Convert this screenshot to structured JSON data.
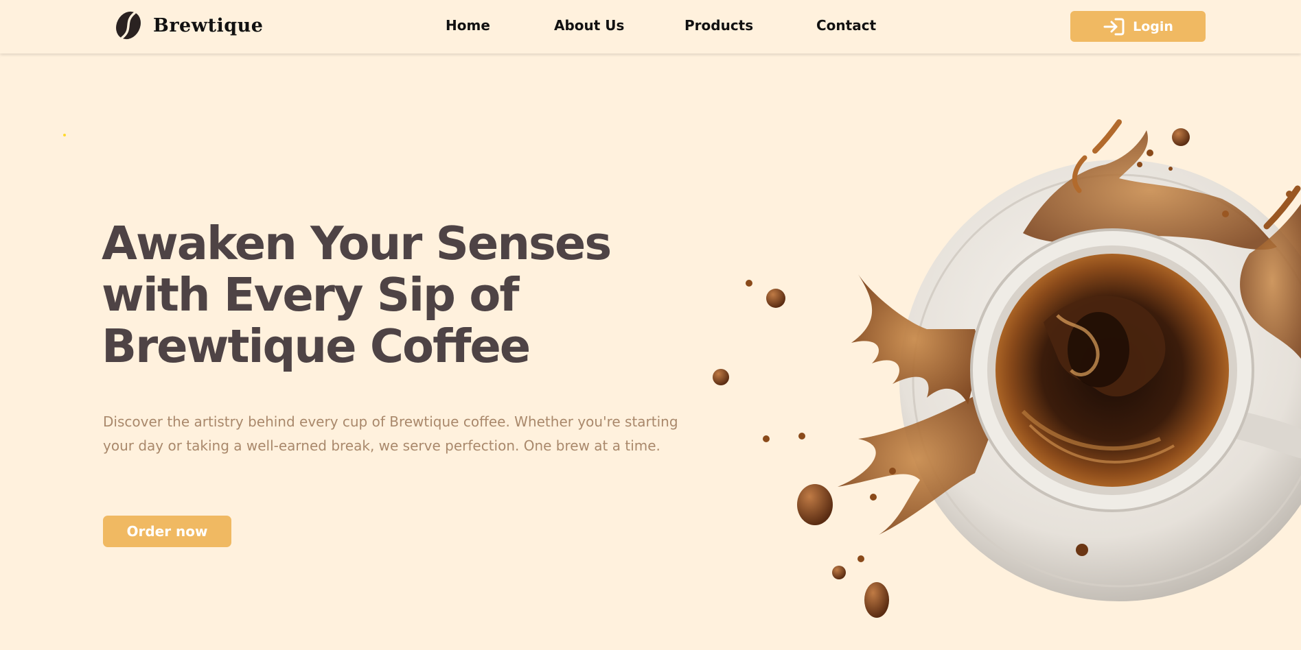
{
  "brand": {
    "name": "Brewtique",
    "logo_icon": "coffee-bean-icon"
  },
  "nav": {
    "items": [
      "Home",
      "About Us",
      "Products",
      "Contact"
    ]
  },
  "login": {
    "label": "Login",
    "icon": "login-icon"
  },
  "hero": {
    "title_lines": [
      "Awaken Your Senses",
      "with Every Sip of",
      "Brewtique Coffee"
    ],
    "description": "Discover the artistry behind every cup of Brewtique coffee. Whether you're starting your day or taking a well-earned break, we serve perfection. One brew at a time.",
    "cta": "Order now"
  },
  "colors": {
    "background": "#fff1dd",
    "accent": "#f0b962",
    "title": "#4e4345",
    "description": "#a9886b"
  }
}
